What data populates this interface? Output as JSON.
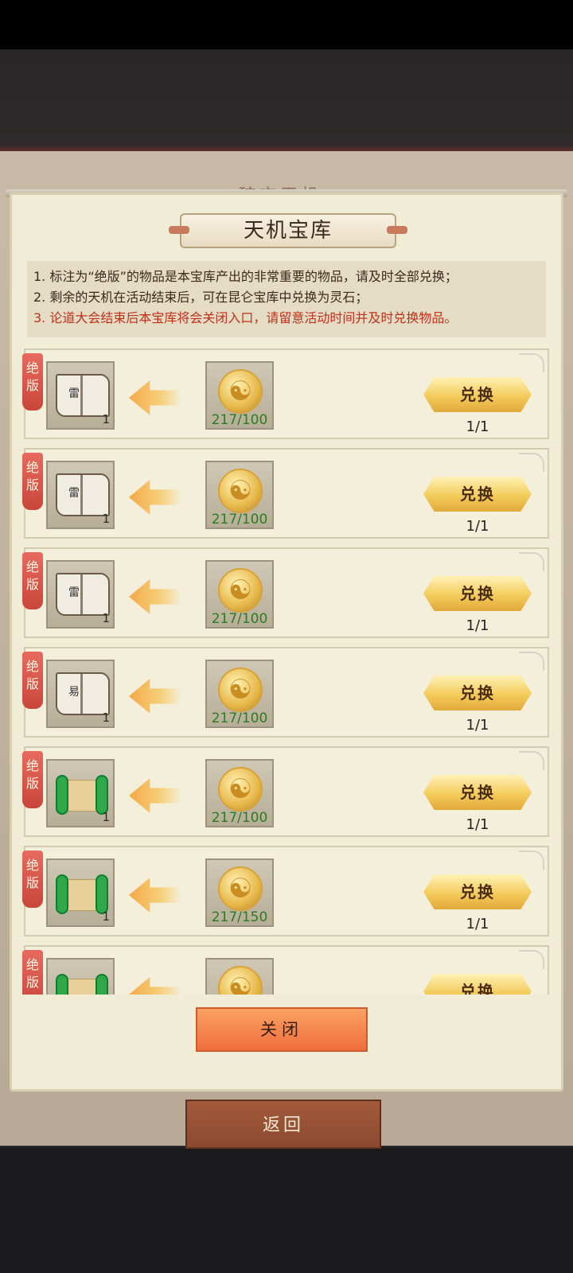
{
  "background": {
    "title_partial": "琼玄天机",
    "return_label": "返回"
  },
  "dialog": {
    "title": "天机宝库",
    "notes": [
      "1. 标注为“绝版”的物品是本宝库产出的非常重要的物品，请及时全部兑换；",
      "2. 剩余的天机在活动结束后，可在昆仑宝库中兑换为灵石；",
      "3. 论道大会结束后本宝库将会关闭入口，请留意活动时间并及时兑换物品。"
    ],
    "tag_label": "绝版",
    "exchange_label": "兑换",
    "rows": [
      {
        "item_icon": "book-icon",
        "item_glyph": "雷",
        "item_qty": "1",
        "cost": "217/100",
        "limit": "1/1"
      },
      {
        "item_icon": "book-icon",
        "item_glyph": "雷",
        "item_qty": "1",
        "cost": "217/100",
        "limit": "1/1"
      },
      {
        "item_icon": "book-icon",
        "item_glyph": "雷",
        "item_qty": "1",
        "cost": "217/100",
        "limit": "1/1"
      },
      {
        "item_icon": "book-icon",
        "item_glyph": "易",
        "item_qty": "1",
        "cost": "217/100",
        "limit": "1/1"
      },
      {
        "item_icon": "scroll-icon",
        "item_glyph": "",
        "item_qty": "1",
        "cost": "217/100",
        "limit": "1/1"
      },
      {
        "item_icon": "scroll-icon",
        "item_glyph": "",
        "item_qty": "1",
        "cost": "217/150",
        "limit": "1/1"
      },
      {
        "item_icon": "scroll-icon",
        "item_glyph": "",
        "item_qty": "",
        "cost": "",
        "limit": ""
      }
    ],
    "close_label": "关闭"
  }
}
